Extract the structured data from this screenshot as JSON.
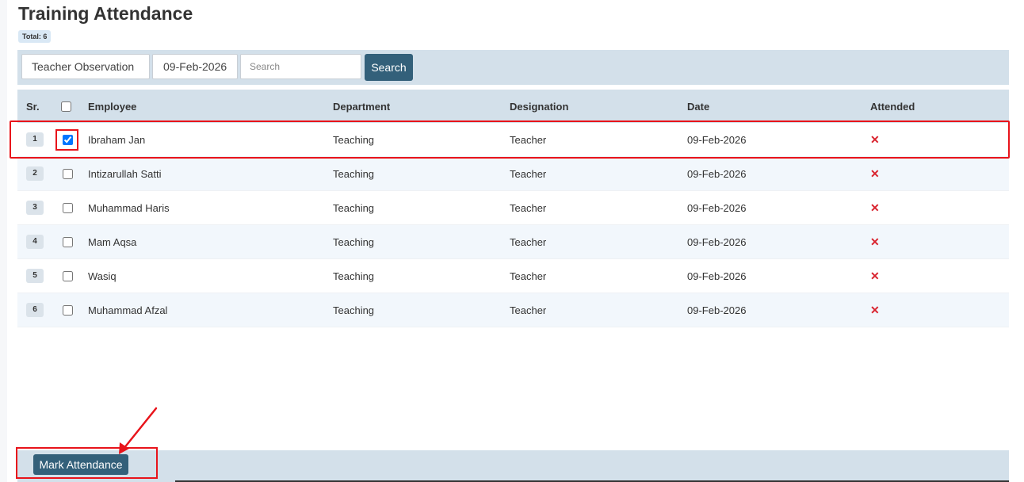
{
  "page": {
    "title": "Training Attendance",
    "total_badge": "Total: 6"
  },
  "filters": {
    "training": "Teacher Observation",
    "date": "09-Feb-2026",
    "search_placeholder": "Search",
    "search_button": "Search"
  },
  "table": {
    "headers": {
      "sr": "Sr.",
      "employee": "Employee",
      "department": "Department",
      "designation": "Designation",
      "date": "Date",
      "attended": "Attended"
    },
    "select_all_checked": false,
    "rows": [
      {
        "sr": "1",
        "checked": true,
        "employee": "Ibraham Jan",
        "department": "Teaching",
        "designation": "Teacher",
        "date": "09-Feb-2026",
        "attended": "✕"
      },
      {
        "sr": "2",
        "checked": false,
        "employee": "Intizarullah Satti",
        "department": "Teaching",
        "designation": "Teacher",
        "date": "09-Feb-2026",
        "attended": "✕"
      },
      {
        "sr": "3",
        "checked": false,
        "employee": "Muhammad Haris",
        "department": "Teaching",
        "designation": "Teacher",
        "date": "09-Feb-2026",
        "attended": "✕"
      },
      {
        "sr": "4",
        "checked": false,
        "employee": "Mam Aqsa",
        "department": "Teaching",
        "designation": "Teacher",
        "date": "09-Feb-2026",
        "attended": "✕"
      },
      {
        "sr": "5",
        "checked": false,
        "employee": "Wasiq",
        "department": "Teaching",
        "designation": "Teacher",
        "date": "09-Feb-2026",
        "attended": "✕"
      },
      {
        "sr": "6",
        "checked": false,
        "employee": "Muhammad Afzal",
        "department": "Teaching",
        "designation": "Teacher",
        "date": "09-Feb-2026",
        "attended": "✕"
      }
    ]
  },
  "footer": {
    "mark_attendance_button": "Mark Attendance"
  },
  "colors": {
    "accent": "#33607a",
    "bar_background": "#d3e0ea",
    "not_attended": "#d9232e",
    "annotation": "#e8141b"
  },
  "icons": {
    "attended_false": "close-icon",
    "annotation": "arrow-icon"
  }
}
